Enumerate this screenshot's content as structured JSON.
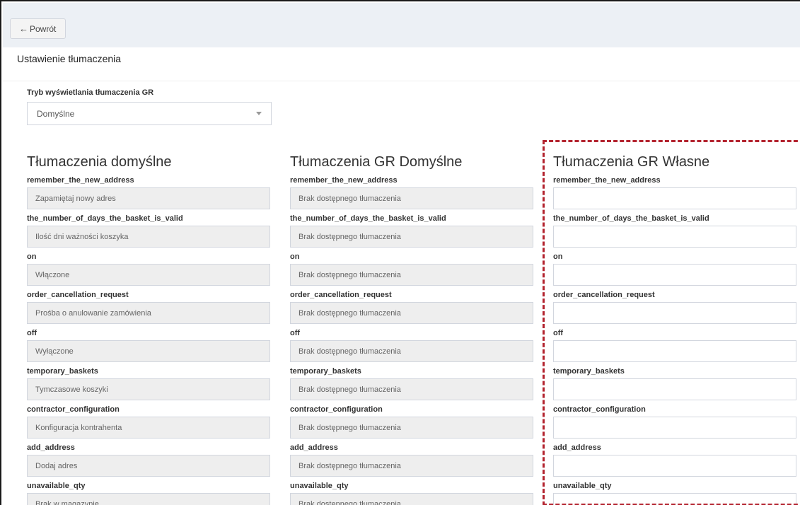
{
  "toolbar": {
    "back_label": "Powrót",
    "back_icon": "arrow-left-icon"
  },
  "page": {
    "title": "Ustawienie tłumaczenia"
  },
  "mode": {
    "label": "Tryb wyświetlania tłumaczenia GR",
    "selected": "Domyślne"
  },
  "columns": [
    {
      "title": "Tłumaczenia domyślne",
      "rows": [
        {
          "key": "remember_the_new_address",
          "value": "Zapamiętaj nowy adres"
        },
        {
          "key": "the_number_of_days_the_basket_is_valid",
          "value": "Ilość dni ważności koszyka"
        },
        {
          "key": "on",
          "value": "Włączone"
        },
        {
          "key": "order_cancellation_request",
          "value": "Prośba o anulowanie zamówienia"
        },
        {
          "key": "off",
          "value": "Wyłączone"
        },
        {
          "key": "temporary_baskets",
          "value": "Tymczasowe koszyki"
        },
        {
          "key": "contractor_configuration",
          "value": "Konfiguracja kontrahenta"
        },
        {
          "key": "add_address",
          "value": "Dodaj adres"
        },
        {
          "key": "unavailable_qty",
          "value": "Brak w magazynie"
        }
      ]
    },
    {
      "title": "Tłumaczenia GR Domyślne",
      "rows": [
        {
          "key": "remember_the_new_address",
          "value": "Brak dostępnego tłumaczenia"
        },
        {
          "key": "the_number_of_days_the_basket_is_valid",
          "value": "Brak dostępnego tłumaczenia"
        },
        {
          "key": "on",
          "value": "Brak dostępnego tłumaczenia"
        },
        {
          "key": "order_cancellation_request",
          "value": "Brak dostępnego tłumaczenia"
        },
        {
          "key": "off",
          "value": "Brak dostępnego tłumaczenia"
        },
        {
          "key": "temporary_baskets",
          "value": "Brak dostępnego tłumaczenia"
        },
        {
          "key": "contractor_configuration",
          "value": "Brak dostępnego tłumaczenia"
        },
        {
          "key": "add_address",
          "value": "Brak dostępnego tłumaczenia"
        },
        {
          "key": "unavailable_qty",
          "value": "Brak dostępnego tłumaczenia"
        }
      ]
    },
    {
      "title": "Tłumaczenia GR Własne",
      "rows": [
        {
          "key": "remember_the_new_address",
          "value": ""
        },
        {
          "key": "the_number_of_days_the_basket_is_valid",
          "value": ""
        },
        {
          "key": "on",
          "value": ""
        },
        {
          "key": "order_cancellation_request",
          "value": ""
        },
        {
          "key": "off",
          "value": ""
        },
        {
          "key": "temporary_baskets",
          "value": ""
        },
        {
          "key": "contractor_configuration",
          "value": ""
        },
        {
          "key": "add_address",
          "value": ""
        },
        {
          "key": "unavailable_qty",
          "value": ""
        }
      ]
    }
  ],
  "colors": {
    "highlight": "#b3232e",
    "topbar_bg": "#ecf0f5",
    "readonly_bg": "#eeeeee"
  }
}
